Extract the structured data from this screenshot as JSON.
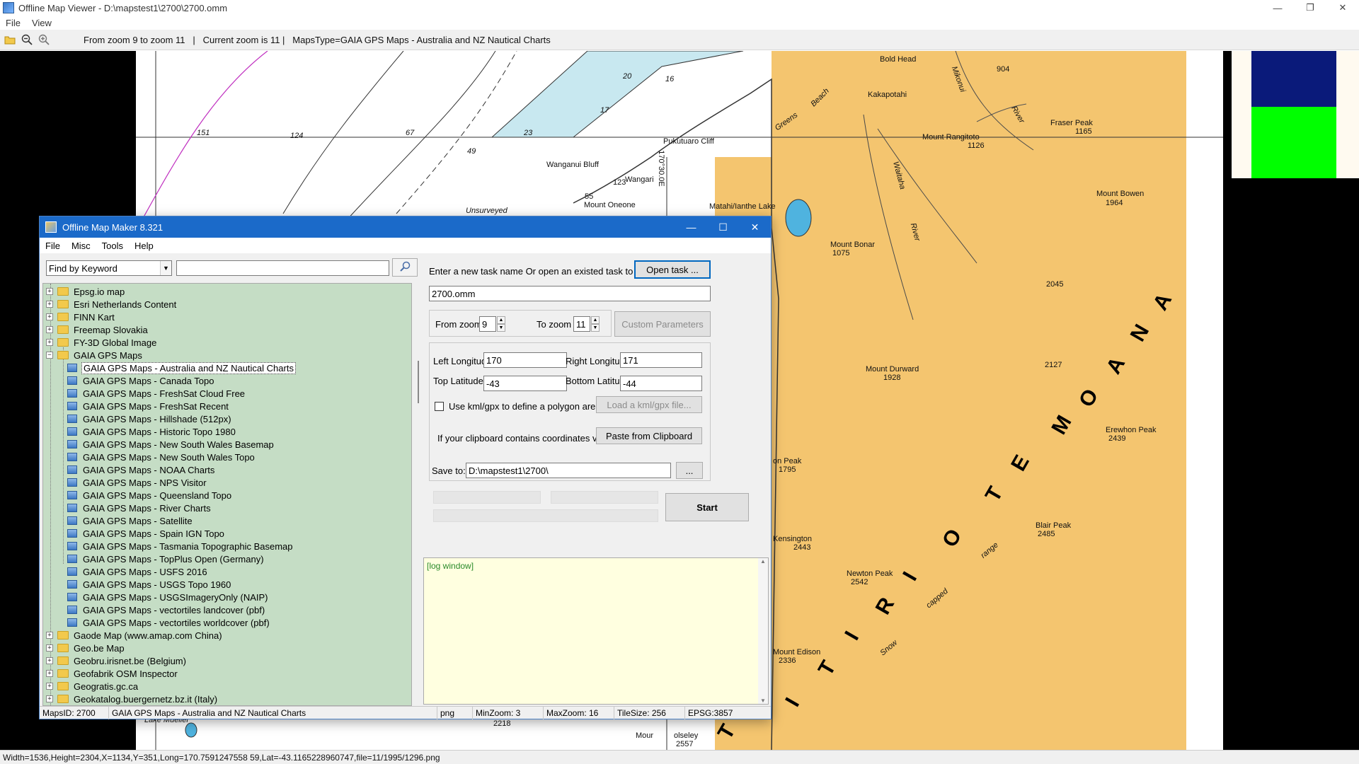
{
  "viewer": {
    "title": "Offline Map Viewer - D:\\mapstest1\\2700\\2700.omm",
    "menu": [
      "File",
      "View"
    ],
    "toolbar_text": "From zoom 9 to zoom 11   |   Current zoom is 11 |   MapsType=GAIA GPS Maps - Australia and NZ Nautical Charts",
    "status": "Width=1536,Height=2304,X=1134,Y=351,Long=170.7591247558 59,Lat=-43.1165228960747,file=11/1995/1296.png",
    "window_buttons": [
      "—",
      "❐",
      "✕"
    ]
  },
  "map": {
    "labels": [
      "Bold Head",
      "904",
      "Kakapotahi",
      "Fraser Peak",
      "1165",
      "Mount Rangitoto",
      "1126",
      "Pukutuaro Cliff",
      "Wanganui Bluff",
      "Wangari",
      "Mount Oneone",
      "55",
      "123",
      "Matahi/Ianthe Lake",
      "Mount Bowen",
      "1964",
      "Mount Bonar",
      "1075",
      "2045",
      "Mount Durward",
      "1928",
      "2127",
      "Erewhon Peak",
      "2439",
      "on Peak",
      "1795",
      "Blair Peak",
      "2485",
      "Kensington",
      "2443",
      "Newton Peak",
      "2542",
      "Mount Edison",
      "2336",
      "Unsurveyed",
      "151",
      "124",
      "67",
      "49",
      "20",
      "16",
      "17",
      "23",
      "Greens",
      "Beach",
      "Mikonui",
      "River",
      "Waitaha",
      "River",
      "range",
      "capped",
      "Snow",
      "2218",
      "Mour",
      "olseley",
      "2557",
      "Lake Mueller",
      "170°30.0E"
    ],
    "big_letters": [
      "A",
      "N",
      "A",
      "O",
      "M",
      "E",
      "T",
      "O",
      "I",
      "R",
      "I",
      "T",
      "I",
      "T"
    ]
  },
  "dialog": {
    "title": "Offline Map Maker 8.321",
    "menu": [
      "File",
      "Misc",
      "Tools",
      "Help"
    ],
    "keyword_select": "Find by Keyword",
    "keyword_input": "",
    "tree": [
      {
        "type": "folder",
        "label": "Epsg.io map",
        "expander": "+"
      },
      {
        "type": "folder",
        "label": "Esri Netherlands Content",
        "expander": "+"
      },
      {
        "type": "folder",
        "label": "FINN Kart",
        "expander": "+"
      },
      {
        "type": "folder",
        "label": "Freemap Slovakia",
        "expander": "+"
      },
      {
        "type": "folder",
        "label": "FY-3D Global Image",
        "expander": "+"
      },
      {
        "type": "folder",
        "label": "GAIA GPS Maps",
        "expander": "−"
      },
      {
        "type": "map",
        "label": "GAIA GPS Maps - Australia and NZ Nautical Charts",
        "selected": true
      },
      {
        "type": "map",
        "label": "GAIA GPS Maps - Canada Topo"
      },
      {
        "type": "map",
        "label": "GAIA GPS Maps - FreshSat Cloud Free"
      },
      {
        "type": "map",
        "label": "GAIA GPS Maps - FreshSat Recent"
      },
      {
        "type": "map",
        "label": "GAIA GPS Maps - Hillshade (512px)"
      },
      {
        "type": "map",
        "label": "GAIA GPS Maps - Historic Topo 1980"
      },
      {
        "type": "map",
        "label": "GAIA GPS Maps - New South Wales Basemap"
      },
      {
        "type": "map",
        "label": "GAIA GPS Maps - New South Wales Topo"
      },
      {
        "type": "map",
        "label": "GAIA GPS Maps - NOAA Charts"
      },
      {
        "type": "map",
        "label": "GAIA GPS Maps - NPS Visitor"
      },
      {
        "type": "map",
        "label": "GAIA GPS Maps - Queensland Topo"
      },
      {
        "type": "map",
        "label": "GAIA GPS Maps - River Charts"
      },
      {
        "type": "map",
        "label": "GAIA GPS Maps - Satellite"
      },
      {
        "type": "map",
        "label": "GAIA GPS Maps - Spain IGN Topo"
      },
      {
        "type": "map",
        "label": "GAIA GPS Maps - Tasmania Topographic Basemap"
      },
      {
        "type": "map",
        "label": "GAIA GPS Maps - TopPlus Open (Germany)"
      },
      {
        "type": "map",
        "label": "GAIA GPS Maps - USFS 2016"
      },
      {
        "type": "map",
        "label": "GAIA GPS Maps - USGS Topo 1960"
      },
      {
        "type": "map",
        "label": "GAIA GPS Maps - USGSImageryOnly (NAIP)"
      },
      {
        "type": "map",
        "label": "GAIA GPS Maps - vectortiles landcover (pbf)"
      },
      {
        "type": "map",
        "label": "GAIA GPS Maps - vectortiles worldcover (pbf)"
      },
      {
        "type": "folder",
        "label": "Gaode Map (www.amap.com China)",
        "expander": "+"
      },
      {
        "type": "folder",
        "label": "Geo.be Map",
        "expander": "+"
      },
      {
        "type": "folder",
        "label": "Geobru.irisnet.be (Belgium)",
        "expander": "+"
      },
      {
        "type": "folder",
        "label": "Geofabrik OSM Inspector",
        "expander": "+"
      },
      {
        "type": "folder",
        "label": "Geogratis.gc.ca",
        "expander": "+"
      },
      {
        "type": "folder",
        "label": "Geokatalog.buergernetz.bz.it (Italy)",
        "expander": "+"
      }
    ],
    "task_prompt": "Enter a new task name Or open an existed task to continue:",
    "open_task_label": "Open task ...",
    "task_name": "2700.omm",
    "from_zoom_label": "From zoom",
    "from_zoom": "9",
    "to_zoom_label": "To zoom",
    "to_zoom": "11",
    "custom_params_label": "Custom Parameters",
    "left_lon_label": "Left Longitude",
    "left_lon": "170",
    "right_lon_label": "Right Longitude",
    "right_lon": "171",
    "top_lat_label": "Top Latitude",
    "top_lat": "-43",
    "bottom_lat_label": "Bottom Latitude",
    "bottom_lat": "-44",
    "kml_check_label": "Use kml/gpx to define a polygon area",
    "load_kml_label": "Load a kml/gpx file...",
    "clipboard_prompt": "If your clipboard contains coordinates values:",
    "paste_label": "Paste from Clipboard",
    "save_to_label": "Save to:",
    "save_to": "D:\\mapstest1\\2700\\",
    "browse_label": "...",
    "start_label": "Start",
    "log_text": "[log window]",
    "window_buttons": [
      "—",
      "☐",
      "✕"
    ],
    "status": {
      "maps_id": "MapsID: 2700",
      "maps_name": "GAIA GPS Maps - Australia and NZ Nautical Charts",
      "format": "png",
      "min_zoom": "MinZoom: 3",
      "max_zoom": "MaxZoom: 16",
      "tile_size": "TileSize: 256",
      "epsg": "EPSG:3857"
    }
  },
  "colors": {
    "land": "#f4c56f",
    "water": "#c8e8f0",
    "tree_bg": "#c5ddc5",
    "dialog_title": "#1b6ac9",
    "log_bg": "#ffffe0"
  }
}
